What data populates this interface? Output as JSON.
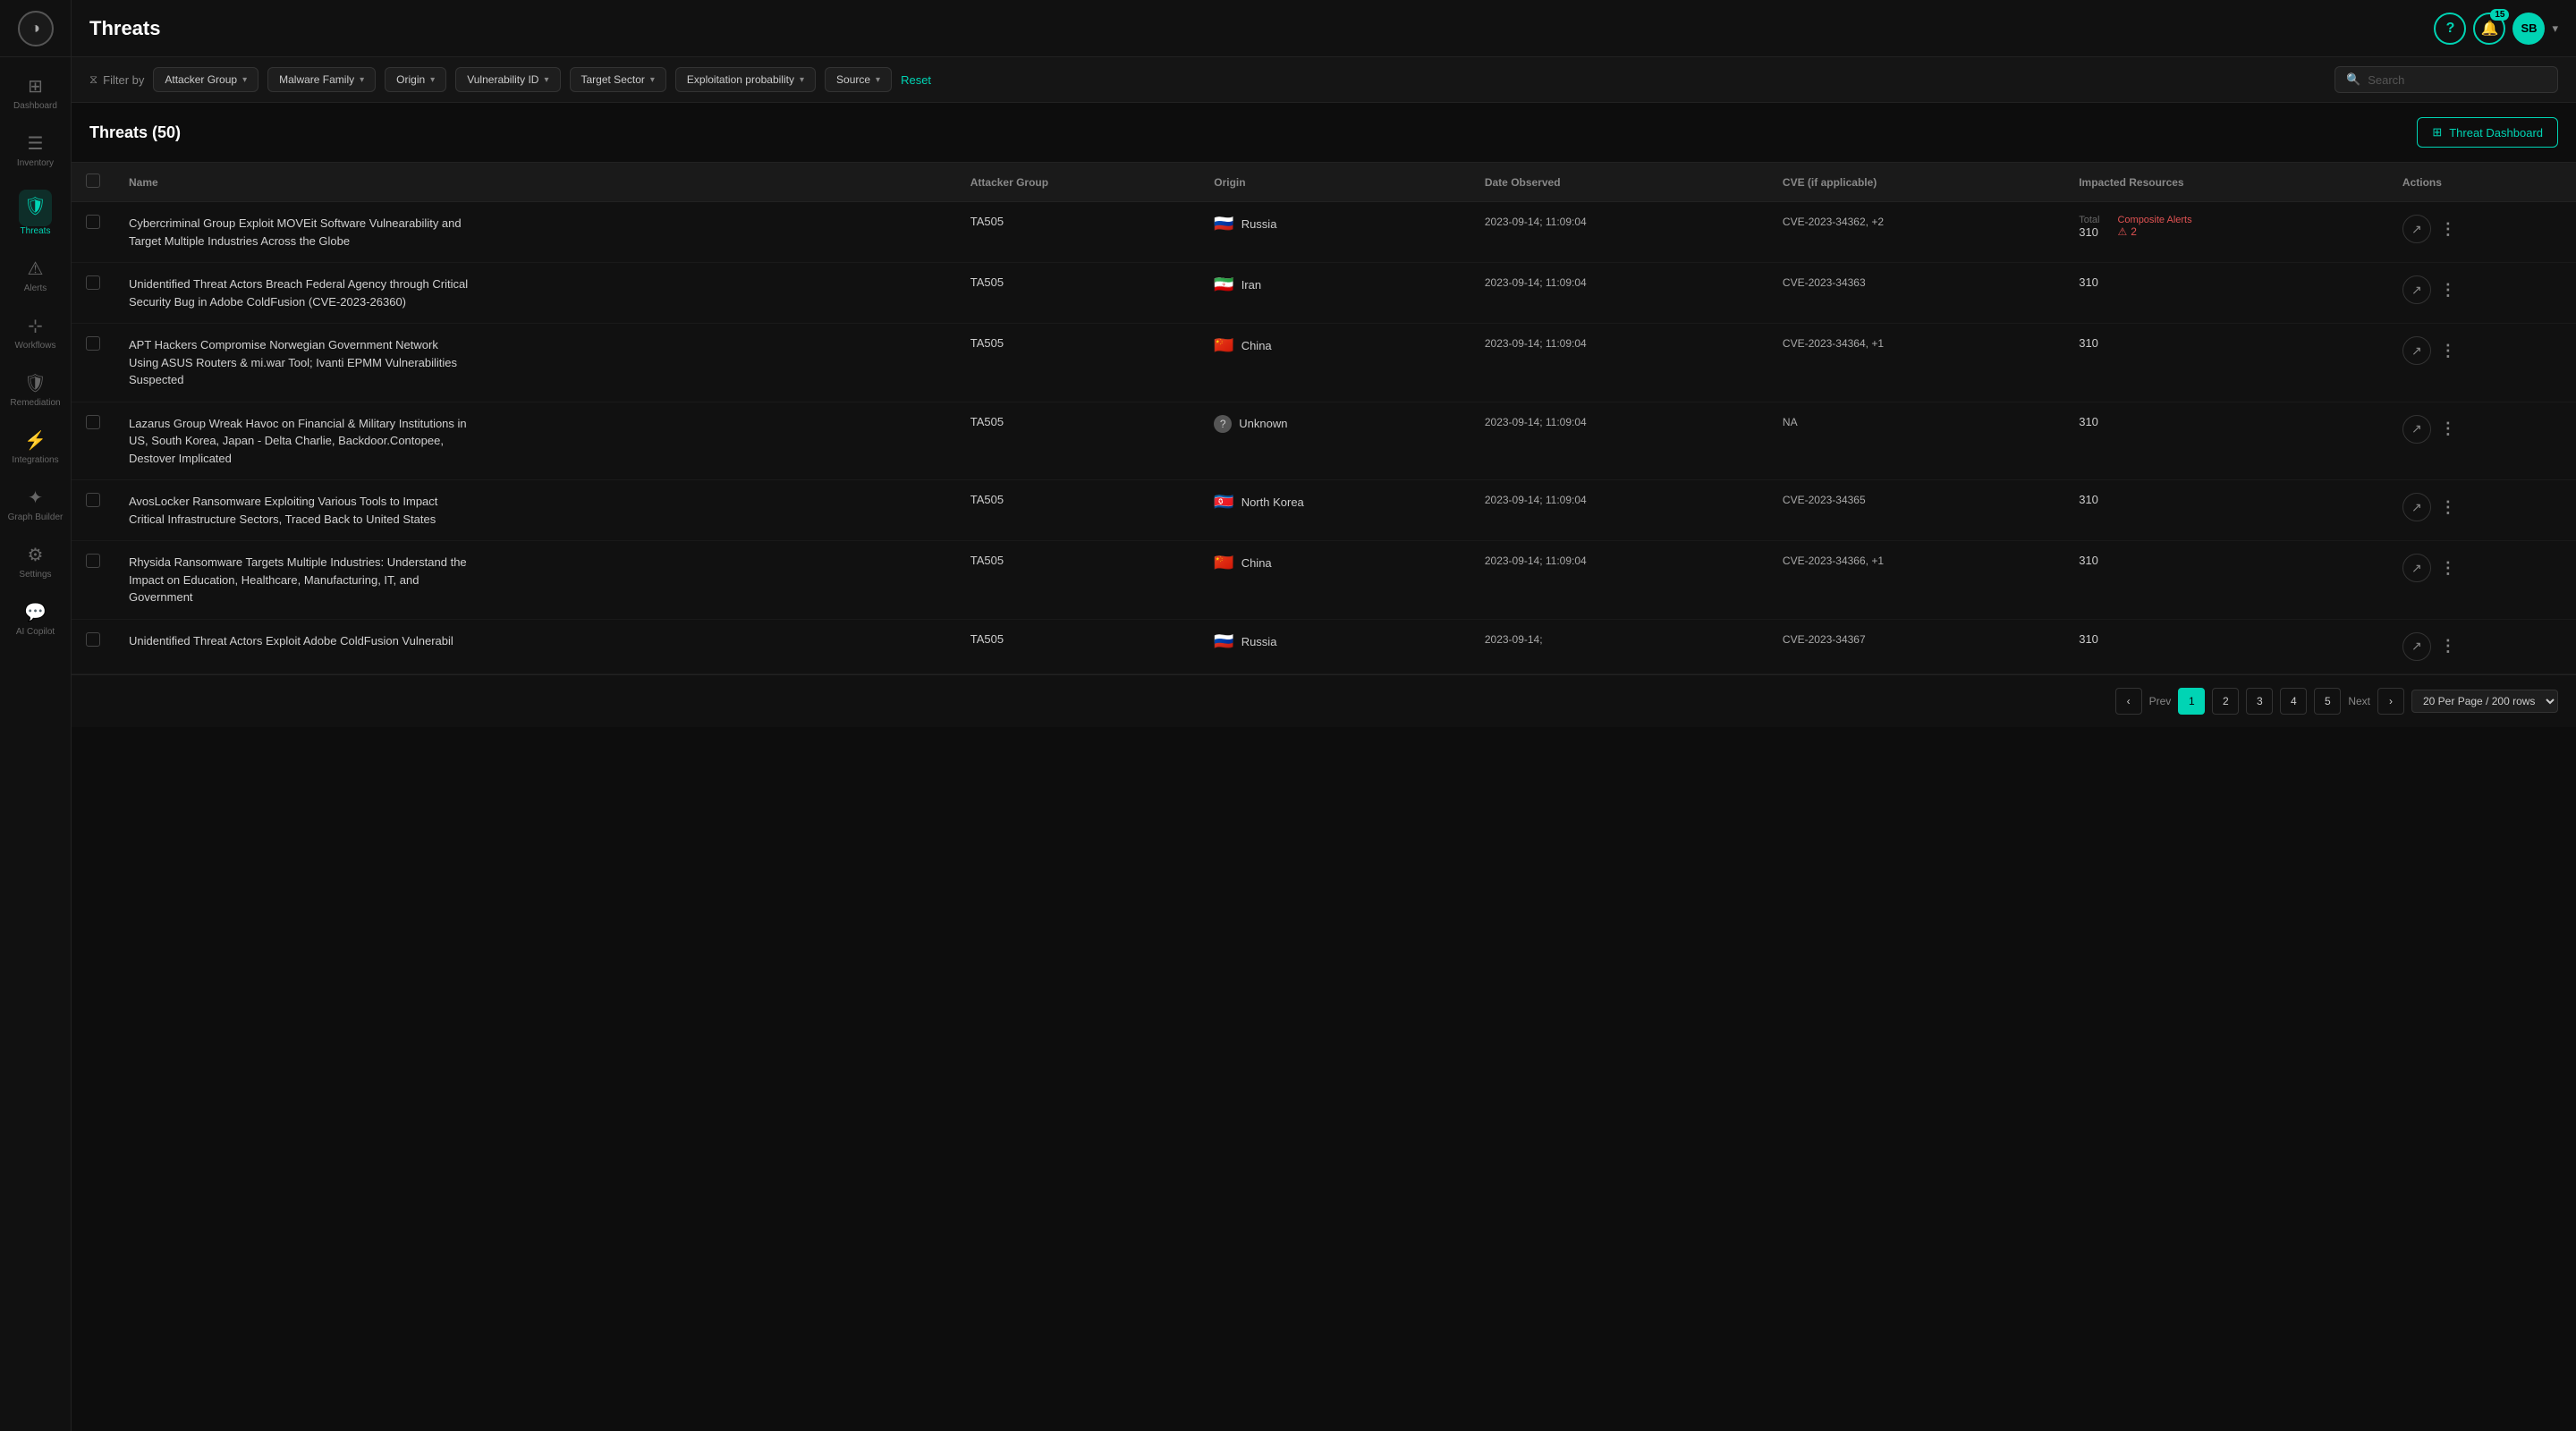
{
  "app": {
    "title": "Threats",
    "logo_symbol": "◑"
  },
  "topbar": {
    "title": "Threats",
    "help_label": "?",
    "notifications_count": "15",
    "bell_icon": "🔔",
    "user_initials": "SB",
    "user_arrow": "▾"
  },
  "sidebar": {
    "items": [
      {
        "id": "dashboard",
        "label": "Dashboard",
        "icon": "⊞",
        "active": false
      },
      {
        "id": "inventory",
        "label": "Inventory",
        "icon": "☰",
        "active": false
      },
      {
        "id": "threats",
        "label": "Threats",
        "icon": "🛡",
        "active": true
      },
      {
        "id": "alerts",
        "label": "Alerts",
        "icon": "⚠",
        "active": false
      },
      {
        "id": "workflows",
        "label": "Workflows",
        "icon": "⊹",
        "active": false
      },
      {
        "id": "remediation",
        "label": "Remediation",
        "icon": "🛠",
        "active": false
      },
      {
        "id": "integrations",
        "label": "Integrations",
        "icon": "⚡",
        "active": false
      },
      {
        "id": "graph-builder",
        "label": "Graph Builder",
        "icon": "✦",
        "active": false
      },
      {
        "id": "settings",
        "label": "Settings",
        "icon": "⚙",
        "active": false
      },
      {
        "id": "ai-copilot",
        "label": "AI Copilot",
        "icon": "💬",
        "active": false
      }
    ]
  },
  "filterbar": {
    "filter_by_label": "Filter by",
    "filters": [
      {
        "id": "attacker-group",
        "label": "Attacker Group"
      },
      {
        "id": "malware-family",
        "label": "Malware Family"
      },
      {
        "id": "origin",
        "label": "Origin"
      },
      {
        "id": "vulnerability-id",
        "label": "Vulnerability ID"
      },
      {
        "id": "target-sector",
        "label": "Target Sector"
      },
      {
        "id": "exploitation-probability",
        "label": "Exploitation probability"
      },
      {
        "id": "source",
        "label": "Source"
      }
    ],
    "reset_label": "Reset",
    "search_placeholder": "Search"
  },
  "threats_header": {
    "count_label": "Threats (50)",
    "dashboard_btn_label": "Threat Dashboard",
    "dashboard_icon": "⊞"
  },
  "table": {
    "columns": [
      {
        "id": "checkbox",
        "label": ""
      },
      {
        "id": "name",
        "label": "Name"
      },
      {
        "id": "attacker-group",
        "label": "Attacker Group"
      },
      {
        "id": "origin",
        "label": "Origin"
      },
      {
        "id": "date-observed",
        "label": "Date Observed"
      },
      {
        "id": "cve",
        "label": "CVE (if applicable)"
      },
      {
        "id": "impacted-resources",
        "label": "Impacted Resources"
      },
      {
        "id": "actions",
        "label": "Actions"
      }
    ],
    "rows": [
      {
        "id": "row-1",
        "name": "Cybercriminal Group Exploit MOVEit Software Vulnearability and Target Multiple Industries Across the Globe",
        "attacker_group": "TA505",
        "origin_flag": "🇷🇺",
        "origin_name": "Russia",
        "date_observed": "2023-09-14; 11:09:04",
        "cve": "CVE-2023-34362, +2",
        "impacted_total": "310",
        "has_alert": true,
        "alert_count": "2",
        "total_label": "Total",
        "composite_label": "Composite Alerts"
      },
      {
        "id": "row-2",
        "name": "Unidentified Threat Actors Breach Federal Agency through Critical Security Bug in Adobe ColdFusion (CVE-2023-26360)",
        "attacker_group": "TA505",
        "origin_flag": "🇮🇷",
        "origin_name": "Iran",
        "date_observed": "2023-09-14; 11:09:04",
        "cve": "CVE-2023-34363",
        "impacted_total": "310",
        "has_alert": false,
        "alert_count": ""
      },
      {
        "id": "row-3",
        "name": "APT Hackers Compromise Norwegian Government Network Using ASUS Routers & mi.war Tool; Ivanti EPMM Vulnerabilities Suspected",
        "attacker_group": "TA505",
        "origin_flag": "🇨🇳",
        "origin_name": "China",
        "date_observed": "2023-09-14; 11:09:04",
        "cve": "CVE-2023-34364, +1",
        "impacted_total": "310",
        "has_alert": false,
        "alert_count": ""
      },
      {
        "id": "row-4",
        "name": "Lazarus Group Wreak Havoc on Financial & Military Institutions in US, South Korea, Japan - Delta Charlie, Backdoor.Contopee, Destover Implicated",
        "attacker_group": "TA505",
        "origin_flag": "❓",
        "origin_name": "Unknown",
        "date_observed": "2023-09-14; 11:09:04",
        "cve": "NA",
        "impacted_total": "310",
        "has_alert": false,
        "alert_count": ""
      },
      {
        "id": "row-5",
        "name": "AvosLocker Ransomware Exploiting Various Tools to Impact Critical Infrastructure Sectors, Traced Back to United States",
        "attacker_group": "TA505",
        "origin_flag": "🇰🇵",
        "origin_name": "North Korea",
        "date_observed": "2023-09-14; 11:09:04",
        "cve": "CVE-2023-34365",
        "impacted_total": "310",
        "has_alert": false,
        "alert_count": ""
      },
      {
        "id": "row-6",
        "name": "Rhysida Ransomware Targets Multiple Industries: Understand the Impact on Education, Healthcare, Manufacturing, IT, and Government",
        "attacker_group": "TA505",
        "origin_flag": "🇨🇳",
        "origin_name": "China",
        "date_observed": "2023-09-14; 11:09:04",
        "cve": "CVE-2023-34366, +1",
        "impacted_total": "310",
        "has_alert": false,
        "alert_count": ""
      },
      {
        "id": "row-7",
        "name": "Unidentified Threat Actors Exploit Adobe ColdFusion Vulnerabil",
        "attacker_group": "TA505",
        "origin_flag": "🇷🇺",
        "origin_name": "Russia",
        "date_observed": "2023-09-14;",
        "cve": "CVE-2023-34367",
        "impacted_total": "310",
        "has_alert": false,
        "alert_count": ""
      }
    ]
  },
  "pagination": {
    "prev_label": "Prev",
    "next_label": "Next",
    "pages": [
      "1",
      "2",
      "3",
      "4",
      "5"
    ],
    "active_page": "1",
    "per_page_label": "20 Per Page / 200 rows",
    "chevron_left": "‹",
    "chevron_right": "›"
  }
}
